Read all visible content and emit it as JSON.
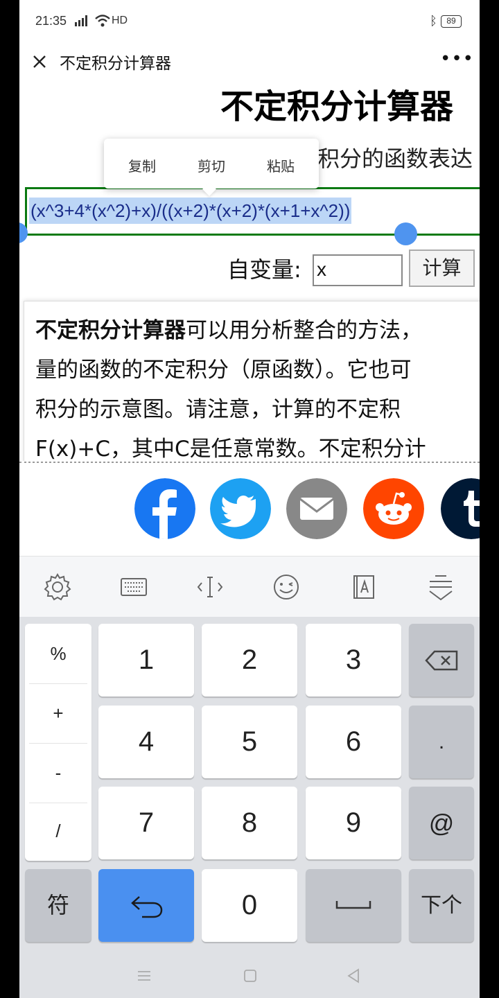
{
  "status": {
    "time": "21:35",
    "network": "HD",
    "battery": "89"
  },
  "appbar": {
    "title": "不定积分计算器"
  },
  "page": {
    "heading": "不定积分计算器",
    "prompt_fragment": "积分的函数表达",
    "context_menu": {
      "copy": "复制",
      "cut": "剪切",
      "paste": "粘贴"
    },
    "expression": "(x^3+4*(x^2)+x)/((x+2)*(x+2)*(x+1+x^2))",
    "variable_label": "自变量:",
    "variable_value": "x",
    "calc_button": "计算",
    "description_bold": "不定积分计算器",
    "description_lines": [
      "可以用分析整合的方法，",
      "量的函数的不定积分（原函数）。它也可",
      "积分的示意图。请注意，计算的不定积",
      "F(x)+C，其中C是任意常数。不定积分计"
    ]
  },
  "share": [
    "facebook-icon",
    "twitter-icon",
    "email-icon",
    "reddit-icon",
    "tumblr-icon"
  ],
  "keyboard": {
    "symbols": [
      "%",
      "+",
      "-",
      "/"
    ],
    "digits": [
      "1",
      "2",
      "3",
      "4",
      "5",
      "6",
      "7",
      "8",
      "9",
      "0"
    ],
    "dot": ".",
    "at": "@",
    "symbols_key": "符",
    "next_key": "下个"
  },
  "colors": {
    "accent_blue": "#4a90f0",
    "expression_border": "#0a7a12",
    "selection": "#bcd6f6"
  }
}
